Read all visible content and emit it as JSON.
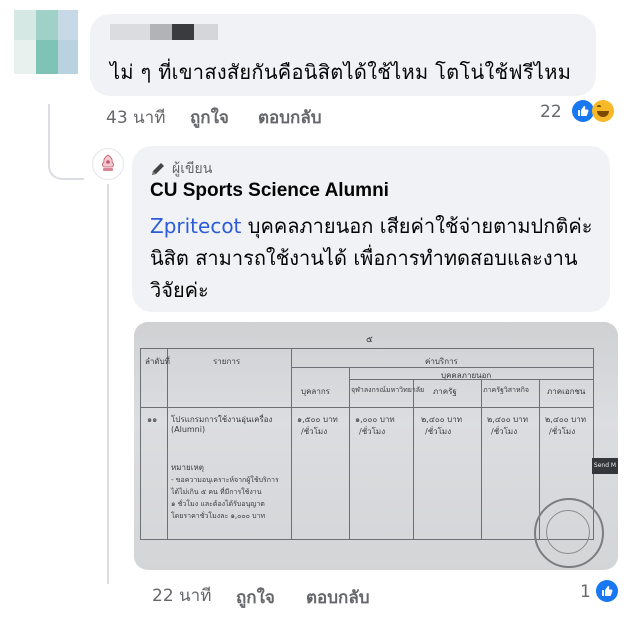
{
  "comment1": {
    "text": "ไม่ ๆ ที่เขาสงสัยกันคือนิสิตได้ใช้ไหม โตโน่ใช้ฟรีไหม",
    "time": "43 นาที",
    "like_label": "ถูกใจ",
    "reply_label": "ตอบกลับ",
    "reaction_count": "22",
    "reactions": [
      "like-icon",
      "haha-icon"
    ]
  },
  "reply": {
    "badge": "ผู้เขียน",
    "author": "CU Sports Science Alumni",
    "mention": "Zpritecot",
    "text": " บุคคลภายนอก เสียค่าใช้จ่ายตามปกติค่ะ นิสิต สามารถใช้งานได้ เพื่อการทำทดสอบและงานวิจัยค่ะ",
    "time": "22 นาที",
    "like_label": "ถูกใจ",
    "reply_label": "ตอบกลับ",
    "reaction_count": "1",
    "reactions": [
      "like-icon"
    ]
  },
  "document": {
    "page_no": "๕",
    "headers": {
      "col_no": "ลำดับที่",
      "col_item": "รายการ",
      "col_fee": "ค่าบริการ",
      "col_staff": "บุคลากร",
      "col_outside": "บุคคลภายนอก",
      "col_uni": "จุฬาลงกรณ์มหาวิทยาลัย",
      "col_gov": "ภาครัฐ",
      "col_state": "ภาครัฐวิสาหกิจ",
      "col_private": "ภาคเอกชน"
    },
    "row": {
      "no": "๑๑",
      "item": "โปรแกรมการใช้งานอุ่นเครื่อง",
      "item_sub": "(Alumni)",
      "fee_staff": "๑,๕๐๐ บาท",
      "fee_uni": "๑,๐๐๐ บาท",
      "fee_gov": "๒,๔๐๐ บาท",
      "fee_state": "๒,๔๐๐ บาท",
      "fee_private": "๒,๔๐๐ บาท",
      "unit": "/ชั่วโมง",
      "note_title": "หมายเหตุ",
      "note_lines": [
        "- ขอความอนุเคราะห์จากผู้ใช้บริการ",
        "ได้ไม่เกิน ๕ คน ที่มีการใช้งาน",
        "๑ ชั่วโมง และต้องได้รับอนุญาต",
        "โดยราคาชั่วโมงละ ๑,๐๐๐ บาท"
      ]
    },
    "side_tag": "Send M"
  }
}
